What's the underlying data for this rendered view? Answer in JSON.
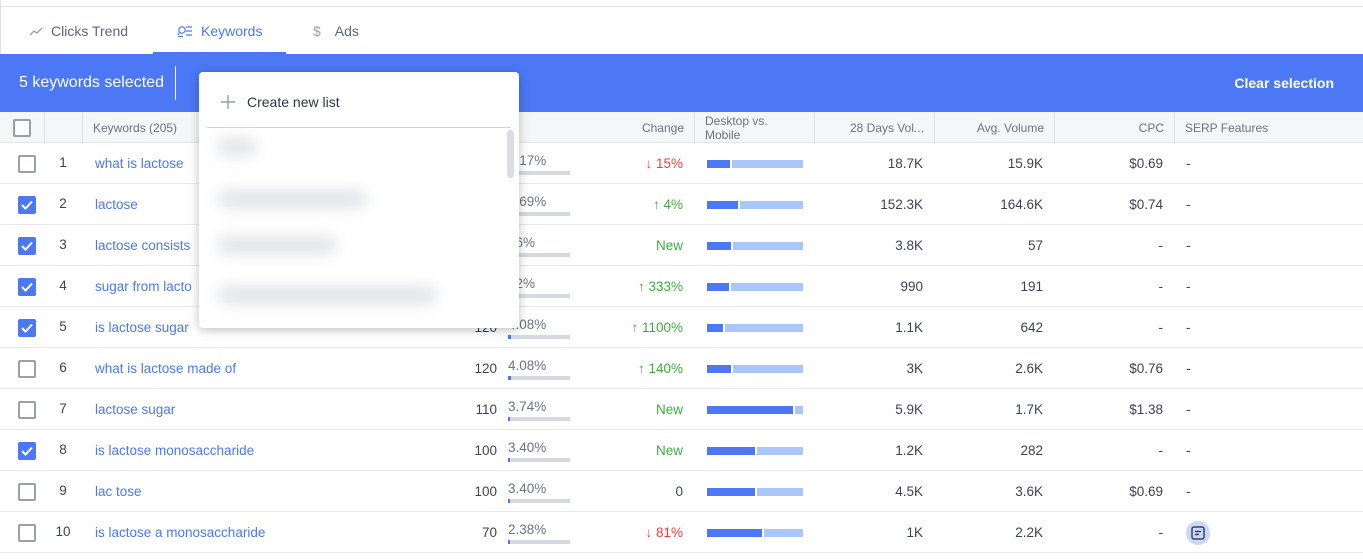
{
  "tabs": [
    {
      "label": "Clicks Trend",
      "icon": "trend-icon"
    },
    {
      "label": "Keywords",
      "icon": "keywords-icon",
      "active": true
    },
    {
      "label": "Ads",
      "icon": "dollar-icon"
    }
  ],
  "selection": {
    "text": "5 keywords selected",
    "clear": "Clear selection"
  },
  "popup": {
    "create": "Create new list"
  },
  "headers": {
    "keywords": "Keywords (205)",
    "change": "Change",
    "dm": "Desktop vs. Mobile",
    "days28": "28 Days Vol...",
    "avg": "Avg. Volume",
    "cpc": "CPC",
    "serp": "SERP Features"
  },
  "colors": {
    "accent": "#4c78f6",
    "up": "#3dae3d",
    "down": "#ef3e36"
  },
  "rows": [
    {
      "n": "1",
      "kw": "what is lactose",
      "checked": false,
      "clicks": "",
      "pct": "5.17%",
      "pf": 0.08,
      "change": "15%",
      "dir": "down",
      "desktop": 0.24,
      "d28": "18.7K",
      "avg": "15.9K",
      "cpc": "$0.69",
      "serp": "-"
    },
    {
      "n": "2",
      "kw": "lactose",
      "checked": true,
      "clicks": "",
      "pct": "7.69%",
      "pf": 0.1,
      "change": "4%",
      "dir": "up",
      "desktop": 0.32,
      "d28": "152.3K",
      "avg": "164.6K",
      "cpc": "$0.74",
      "serp": "-"
    },
    {
      "n": "3",
      "kw": "lactose consists",
      "checked": true,
      "clicks": "",
      "pct": "16%",
      "pf": 0.05,
      "change": "New",
      "dir": "new",
      "desktop": 0.25,
      "d28": "3.8K",
      "avg": "57",
      "cpc": "-",
      "serp": "-"
    },
    {
      "n": "4",
      "kw": "sugar from lacto",
      "checked": true,
      "clicks": "",
      "pct": "42%",
      "pf": 0.05,
      "change": "333%",
      "dir": "up",
      "desktop": 0.23,
      "d28": "990",
      "avg": "191",
      "cpc": "-",
      "serp": "-"
    },
    {
      "n": "5",
      "kw": "is lactose sugar",
      "checked": true,
      "clicks": "120",
      "pct": "4.08%",
      "pf": 0.05,
      "change": "1100%",
      "dir": "up",
      "desktop": 0.17,
      "d28": "1.1K",
      "avg": "642",
      "cpc": "-",
      "serp": "-"
    },
    {
      "n": "6",
      "kw": "what is lactose made of",
      "checked": false,
      "clicks": "120",
      "pct": "4.08%",
      "pf": 0.05,
      "change": "140%",
      "dir": "up",
      "desktop": 0.25,
      "d28": "3K",
      "avg": "2.6K",
      "cpc": "$0.76",
      "serp": "-"
    },
    {
      "n": "7",
      "kw": "lactose sugar",
      "checked": false,
      "clicks": "110",
      "pct": "3.74%",
      "pf": 0.04,
      "change": "New",
      "dir": "new",
      "desktop": 0.9,
      "d28": "5.9K",
      "avg": "1.7K",
      "cpc": "$1.38",
      "serp": "-"
    },
    {
      "n": "8",
      "kw": "is lactose monosaccharide",
      "checked": true,
      "clicks": "100",
      "pct": "3.40%",
      "pf": 0.04,
      "change": "New",
      "dir": "new",
      "desktop": 0.5,
      "d28": "1.2K",
      "avg": "282",
      "cpc": "-",
      "serp": "-"
    },
    {
      "n": "9",
      "kw": "lac tose",
      "checked": false,
      "clicks": "100",
      "pct": "3.40%",
      "pf": 0.04,
      "change": "0",
      "dir": "neutral",
      "desktop": 0.5,
      "d28": "4.5K",
      "avg": "3.6K",
      "cpc": "$0.69",
      "serp": "-"
    },
    {
      "n": "10",
      "kw": "is lactose a monosaccharide",
      "checked": false,
      "clicks": "70",
      "pct": "2.38%",
      "pf": 0.03,
      "change": "81%",
      "dir": "down",
      "desktop": 0.57,
      "d28": "1K",
      "avg": "2.2K",
      "cpc": "-",
      "serp": "featured-snippet-icon"
    }
  ]
}
